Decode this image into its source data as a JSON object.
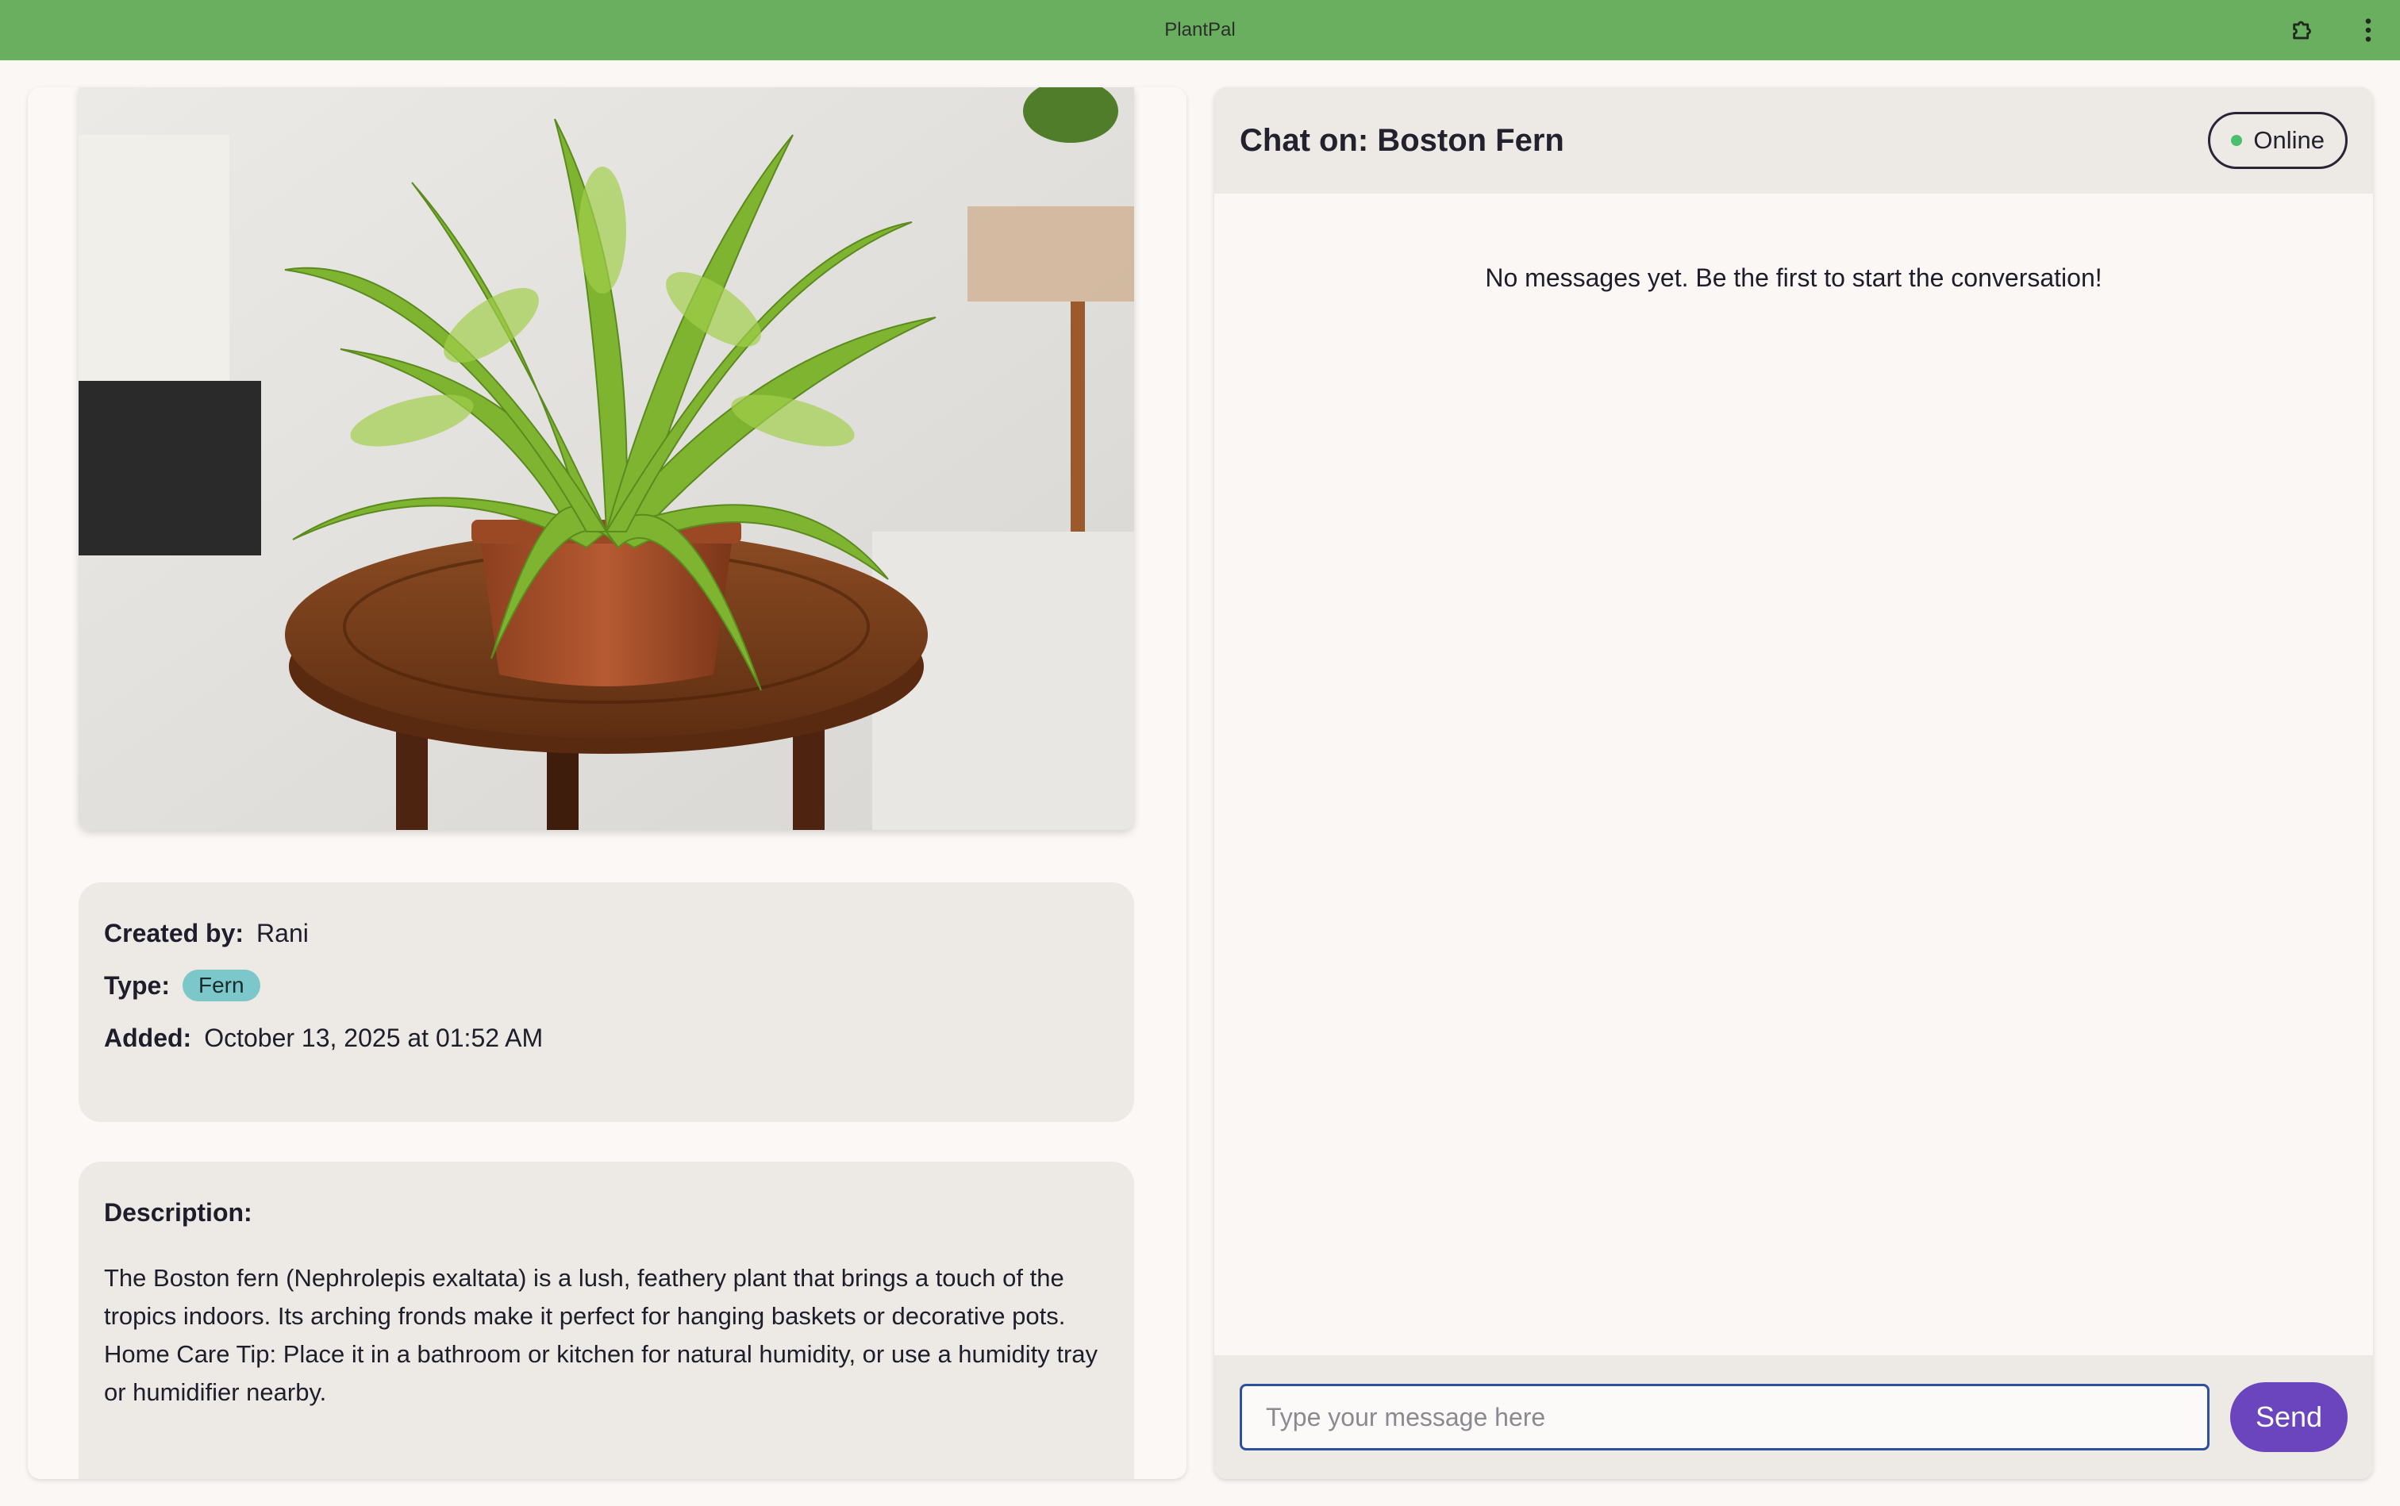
{
  "app": {
    "title": "PlantPal"
  },
  "icons": {
    "extension": "puzzle-icon",
    "menu": "kebab-menu-icon"
  },
  "plant": {
    "image_alt": "Boston fern on wooden stool",
    "created_by_label": "Created by:",
    "created_by": "Rani",
    "type_label": "Type:",
    "type": "Fern",
    "added_label": "Added:",
    "added": "October 13, 2025 at 01:52 AM",
    "description_label": "Description:",
    "description": "The Boston fern (Nephrolepis exaltata) is a lush, feathery plant that brings a touch of the tropics indoors. Its arching fronds make it perfect for hanging baskets or decorative pots. Home Care Tip: Place it in a bathroom or kitchen for natural humidity, or use a humidity tray or humidifier nearby."
  },
  "chat": {
    "title": "Chat on: Boston Fern",
    "status": "Online",
    "empty_message": "No messages yet. Be the first to start the conversation!",
    "input_placeholder": "Type your message here",
    "send_label": "Send"
  },
  "colors": {
    "titlebar": "#6aae5f",
    "send_button": "#6a45be",
    "type_badge": "#7cc7c9",
    "online_dot": "#4bbf6b"
  }
}
